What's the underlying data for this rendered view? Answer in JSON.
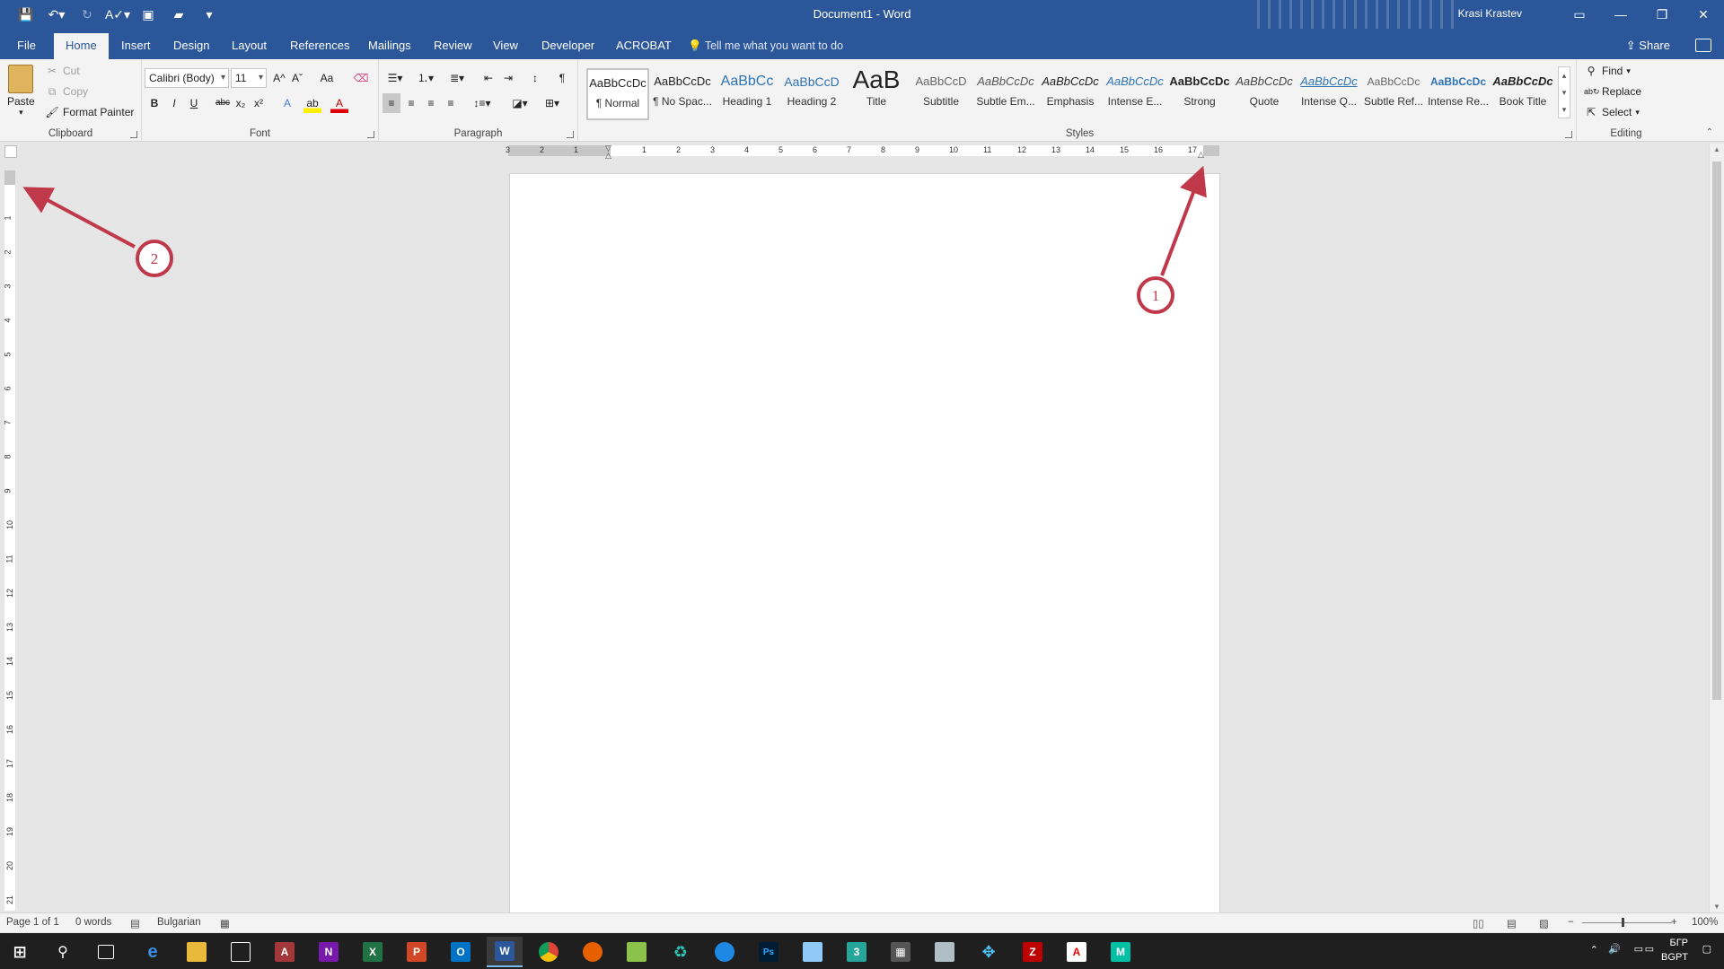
{
  "titlebar": {
    "doc_title": "Document1 - Word",
    "user": "Krasi Krastev"
  },
  "tabs": [
    {
      "label": "File",
      "active": false
    },
    {
      "label": "Home",
      "active": true
    },
    {
      "label": "Insert",
      "active": false
    },
    {
      "label": "Design",
      "active": false
    },
    {
      "label": "Layout",
      "active": false
    },
    {
      "label": "References",
      "active": false
    },
    {
      "label": "Mailings",
      "active": false
    },
    {
      "label": "Review",
      "active": false
    },
    {
      "label": "View",
      "active": false
    },
    {
      "label": "Developer",
      "active": false
    },
    {
      "label": "ACROBAT",
      "active": false
    }
  ],
  "tellme": "Tell me what you want to do",
  "share": "Share",
  "clipboard": {
    "label": "Clipboard",
    "paste": "Paste",
    "cut": "Cut",
    "copy": "Copy",
    "format_painter": "Format Painter"
  },
  "font": {
    "label": "Font",
    "family": "Calibri (Body)",
    "size": "11",
    "bold": "B",
    "italic": "I",
    "underline": "U",
    "strike": "abc",
    "sub": "x₂",
    "sup": "x²",
    "grow": "A^",
    "shrink": "Aˇ",
    "case": "Aa"
  },
  "paragraph": {
    "label": "Paragraph",
    "pilcrow": "¶"
  },
  "styles": {
    "label": "Styles",
    "items": [
      {
        "preview": "AaBbCcDc",
        "name": "¶ Normal"
      },
      {
        "preview": "AaBbCcDc",
        "name": "¶ No Spac..."
      },
      {
        "preview": "AaBbCc",
        "name": "Heading 1"
      },
      {
        "preview": "AaBbCcD",
        "name": "Heading 2"
      },
      {
        "preview": "AaB",
        "name": "Title"
      },
      {
        "preview": "AaBbCcD",
        "name": "Subtitle"
      },
      {
        "preview": "AaBbCcDc",
        "name": "Subtle Em..."
      },
      {
        "preview": "AaBbCcDc",
        "name": "Emphasis"
      },
      {
        "preview": "AaBbCcDc",
        "name": "Intense E..."
      },
      {
        "preview": "AaBbCcDc",
        "name": "Strong"
      },
      {
        "preview": "AaBbCcDc",
        "name": "Quote"
      },
      {
        "preview": "AaBbCcDc",
        "name": "Intense Q..."
      },
      {
        "preview": "AaBbCcDc",
        "name": "Subtle Ref..."
      },
      {
        "preview": "AaBbCcDc",
        "name": "Intense Re..."
      },
      {
        "preview": "AaBbCcDc",
        "name": "Book Title"
      }
    ]
  },
  "editing": {
    "label": "Editing",
    "find": "Find",
    "replace": "Replace",
    "select": "Select"
  },
  "hruler_labels": [
    "3",
    "2",
    "1",
    "1",
    "2",
    "3",
    "4",
    "5",
    "6",
    "7",
    "8",
    "9",
    "10",
    "11",
    "12",
    "13",
    "14",
    "15",
    "16",
    "17"
  ],
  "vruler_labels": [
    "1",
    "2",
    "3",
    "4",
    "5",
    "6",
    "7",
    "8",
    "9",
    "10",
    "11",
    "12",
    "13",
    "14",
    "15",
    "16",
    "17",
    "18",
    "19",
    "20",
    "21"
  ],
  "statusbar": {
    "page": "Page 1 of 1",
    "words": "0 words",
    "language": "Bulgarian",
    "zoom": "100%"
  },
  "tray": {
    "lang": "БГР",
    "layout": "BGPT"
  },
  "annotations": [
    {
      "label": "1"
    },
    {
      "label": "2"
    }
  ],
  "colors": {
    "accent": "#2b579a",
    "annotation": "#c0394b"
  }
}
